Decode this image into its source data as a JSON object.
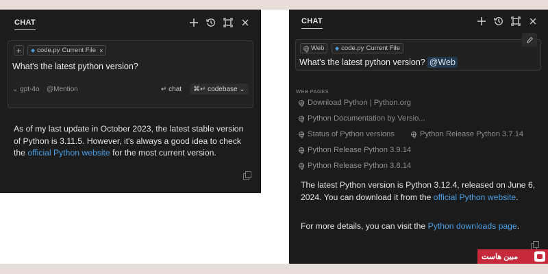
{
  "left_panel": {
    "title": "CHAT",
    "icons": [
      "plus-icon",
      "history-icon",
      "maximize-icon",
      "close-icon"
    ],
    "context": {
      "add_label": "+",
      "file_chip": "code.py",
      "file_chip_suffix": "Current File",
      "remove": "×"
    },
    "query": "What's the latest python version?",
    "model": "gpt-4o",
    "mention": "@Mention",
    "chat_button": "chat",
    "codebase_button": "codebase",
    "answer": {
      "part1": "As of my last update in October 2023, the latest stable version of Python is 3.11.5. However, it's always a good idea to check the ",
      "link": "official Python website",
      "part2": " for the most current version."
    }
  },
  "right_panel": {
    "title": "CHAT",
    "icons": [
      "plus-icon",
      "history-icon",
      "maximize-icon",
      "close-icon",
      "pencil-icon"
    ],
    "context": {
      "web_chip": "Web",
      "file_chip": "code.py",
      "file_chip_suffix": "Current File"
    },
    "query": "What's the latest python version?",
    "query_tag": "@Web",
    "section_label": "WEB PAGES",
    "web_pages": [
      "Download Python | Python.org",
      "Python Documentation by Versio...",
      "Status of Python versions",
      "Python Release Python 3.7.14",
      "Python Release Python 3.9.14",
      "Python Release Python 3.8.14"
    ],
    "answer": {
      "part1": "The latest Python version is Python 3.12.4, released on June 6, 2024. You can download it from the ",
      "link": "official Python website",
      "part2": ".",
      "more_part1": "For more details, you can visit the ",
      "more_link": "Python downloads page",
      "more_part2": "."
    }
  },
  "watermark": {
    "text": "مبین هاست"
  },
  "colors": {
    "panel_bg": "#1c1c1c",
    "link": "#4a9fe6",
    "outer_strip": "#e7ddd9",
    "watermark": "#c62a3a"
  }
}
